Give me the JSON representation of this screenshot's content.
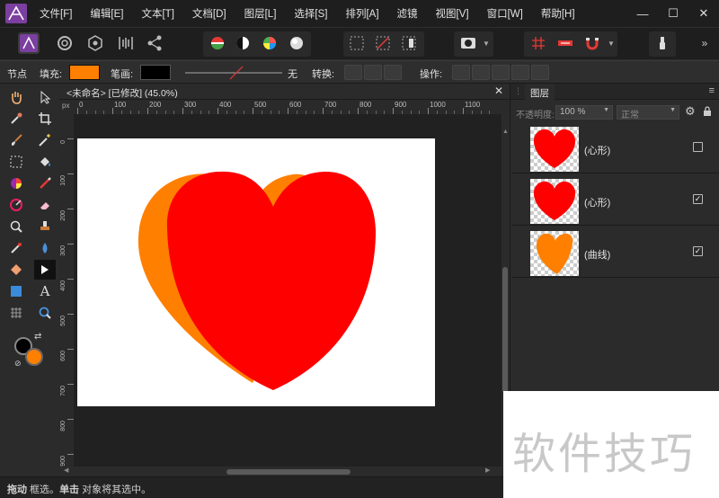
{
  "menubar": {
    "items": [
      "文件[F]",
      "编辑[E]",
      "文本[T]",
      "文档[D]",
      "图层[L]",
      "选择[S]",
      "排列[A]",
      "滤镜",
      "视图[V]",
      "窗口[W]",
      "帮助[H]"
    ],
    "minimize": "—",
    "maximize": "☐",
    "close": "✕"
  },
  "context": {
    "node_label": "节点",
    "fill_label": "填充:",
    "fill_color": "#ff7f00",
    "stroke_label": "笔画:",
    "stroke_color": "#000000",
    "stroke_none": "无",
    "convert_label": "转换:",
    "action_label": "操作:"
  },
  "document": {
    "tab_title": "<未命名> [已修改] (45.0%)",
    "close": "✕",
    "ruler_unit": "px",
    "ruler_top_ticks": [
      "0",
      "100",
      "200",
      "300",
      "400",
      "500",
      "600",
      "700",
      "800",
      "900",
      "1000",
      "1100"
    ],
    "ruler_left_ticks": [
      "0",
      "100",
      "200",
      "300",
      "400",
      "500",
      "600",
      "700",
      "800",
      "900"
    ]
  },
  "canvas": {
    "heart_front_color": "#ff0000",
    "heart_back_color": "#ff7f00"
  },
  "layers_panel": {
    "tab_label": "图层",
    "opacity_label": "不透明度:",
    "opacity_value": "100 %",
    "blend_mode": "正常",
    "layers": [
      {
        "name": "(心形)",
        "checked": false,
        "color": "#ff0000"
      },
      {
        "name": "(心形)",
        "checked": true,
        "color": "#ff0000"
      },
      {
        "name": "(曲线)",
        "checked": true,
        "color": "#ff7f00"
      }
    ]
  },
  "status": {
    "drag": "拖动",
    "drag_text": " 框选。",
    "click": "单击",
    "click_text": " 对象将其选中。"
  },
  "watermark": "软件技巧"
}
